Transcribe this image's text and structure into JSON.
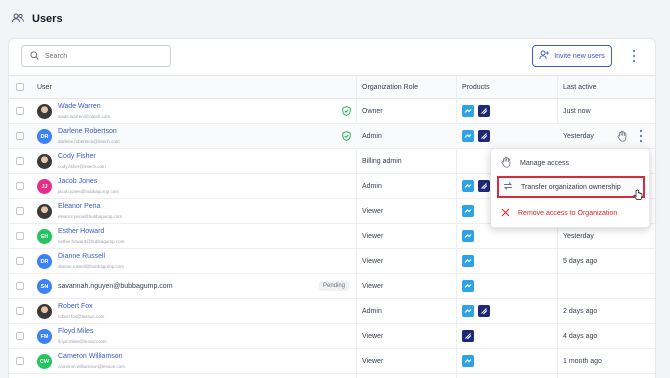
{
  "page": {
    "title": "Users",
    "title_icon": "users-icon"
  },
  "toolbar": {
    "search_placeholder": "Search",
    "invite_label": "Invite new users",
    "invite_icon": "person-add-icon",
    "more_icon": "kebab-icon"
  },
  "table": {
    "columns": [
      "User",
      "Organization Role",
      "Products",
      "Last active"
    ],
    "rows": [
      {
        "name": "Wade Warren",
        "email": "wade.warren@intech.com",
        "initials": "",
        "avatar_color": "",
        "photo": true,
        "verified": true,
        "role": "Owner",
        "products": [
          "a",
          "b"
        ],
        "last_active": "Just now",
        "pending": ""
      },
      {
        "name": "Darlene Robertson",
        "email": "darlene.robertson@intech.com",
        "initials": "DR",
        "avatar_color": "#3b82f6",
        "photo": false,
        "verified": true,
        "role": "Admin",
        "products": [
          "a",
          "b"
        ],
        "last_active": "Yesterday",
        "pending": "",
        "hovered": true
      },
      {
        "name": "Cody Fisher",
        "email": "cody.fisher@intech.com",
        "initials": "",
        "avatar_color": "",
        "photo": true,
        "verified": false,
        "role": "Billing admin",
        "products": [],
        "last_active": "",
        "pending": ""
      },
      {
        "name": "Jacob Jones",
        "email": "jacob.jones@bubbagump.com",
        "initials": "JJ",
        "avatar_color": "#e52e8a",
        "photo": false,
        "verified": false,
        "role": "Admin",
        "products": [
          "a",
          "b"
        ],
        "last_active": "",
        "pending": ""
      },
      {
        "name": "Eleanor Pena",
        "email": "eleanor.pena@bubbagump.com",
        "initials": "",
        "avatar_color": "",
        "photo": true,
        "verified": false,
        "role": "Viewer",
        "products": [
          "a"
        ],
        "last_active": "",
        "pending": ""
      },
      {
        "name": "Esther Howard",
        "email": "esther.howard@bubbagump.com",
        "initials": "EH",
        "avatar_color": "#22c55e",
        "photo": false,
        "verified": false,
        "role": "Viewer",
        "products": [
          "a"
        ],
        "last_active": "Yesterday",
        "pending": ""
      },
      {
        "name": "Dianne Russell",
        "email": "dianne.russell@bubbagump.com",
        "initials": "DR",
        "avatar_color": "#3b82f6",
        "photo": false,
        "verified": false,
        "role": "Viewer",
        "products": [
          "a"
        ],
        "last_active": "5 days ago",
        "pending": ""
      },
      {
        "name": "savannah.nguyen@bubbagump.com",
        "email": "",
        "initials": "SN",
        "avatar_color": "#3b82f6",
        "photo": false,
        "verified": false,
        "role": "Viewer",
        "products": [
          "a"
        ],
        "last_active": "",
        "pending": "Pending"
      },
      {
        "name": "Robert Fox",
        "email": "robert.fox@lesson.com",
        "initials": "",
        "avatar_color": "",
        "photo": true,
        "verified": false,
        "role": "Admin",
        "products": [
          "a",
          "b"
        ],
        "last_active": "2 days ago",
        "pending": ""
      },
      {
        "name": "Floyd Miles",
        "email": "floyd.miles@lesson.com",
        "initials": "FM",
        "avatar_color": "#3b82f6",
        "photo": false,
        "verified": false,
        "role": "Viewer",
        "products": [
          "b"
        ],
        "last_active": "4 days ago",
        "pending": ""
      },
      {
        "name": "Cameron Williamson",
        "email": "cameron.williamson@lesson.com",
        "initials": "CW",
        "avatar_color": "#22c55e",
        "photo": false,
        "verified": false,
        "role": "Viewer",
        "products": [
          "a"
        ],
        "last_active": "1 month ago",
        "pending": ""
      }
    ]
  },
  "context_menu": {
    "items": [
      {
        "label": "Manage access",
        "icon": "hand-icon"
      },
      {
        "label": "Transfer organization ownership",
        "icon": "transfer-icon",
        "highlighted": true
      },
      {
        "label": "Remove access to Organization",
        "icon": "close-icon",
        "danger": true
      }
    ]
  },
  "colors": {
    "accent": "#3b5ccc",
    "danger": "#dc2626",
    "highlight_border": "#d62b3a",
    "product_a": "#2ea3e6",
    "product_b": "#1e2a78"
  }
}
